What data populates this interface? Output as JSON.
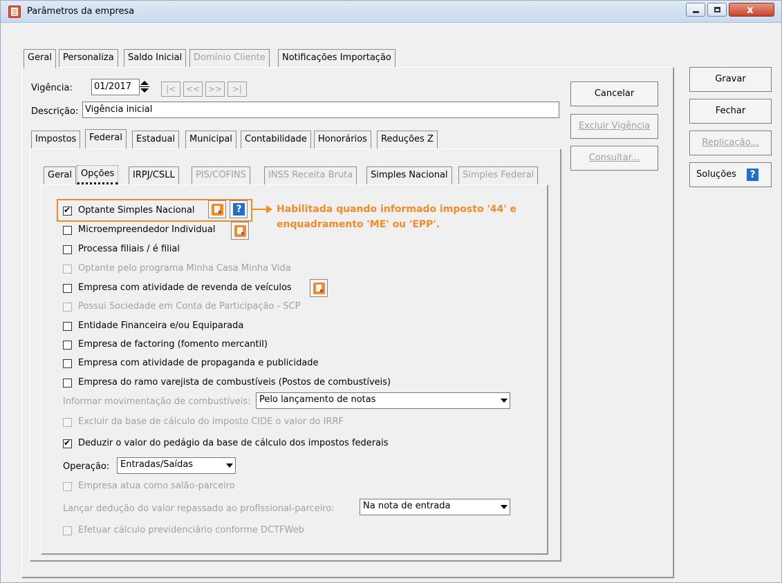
{
  "window": {
    "title": "Parâmetros da empresa",
    "close_symbol": "x"
  },
  "top_tabs": [
    "Geral",
    "Personaliza",
    "Saldo Inicial",
    "Domínio Cliente",
    "Notificações Importação"
  ],
  "vigencia": {
    "label": "Vigência:",
    "value": "01/2017",
    "nav": [
      "|<",
      "<<",
      ">>",
      ">|"
    ]
  },
  "descricao": {
    "label": "Descrição:",
    "value": "Vigência inicial"
  },
  "mid_tabs": [
    "Impostos",
    "Federal",
    "Estadual",
    "Municipal",
    "Contabilidade",
    "Honorários",
    "Reduções Z"
  ],
  "inner_tabs": [
    "Geral",
    "Opções",
    "IRPJ/CSLL",
    "PIS/COFINS",
    "INSS Receita Bruta",
    "Simples Nacional",
    "Simples Federal"
  ],
  "options": [
    {
      "label": "Optante Simples Nacional",
      "checked": true,
      "enabled": true
    },
    {
      "label": "Microempreendedor Individual",
      "checked": false,
      "enabled": true
    },
    {
      "label": "Processa filiais / é filial",
      "checked": false,
      "enabled": true
    },
    {
      "label": "Optante pelo programa Minha Casa Minha Vida",
      "checked": false,
      "enabled": false
    },
    {
      "label": "Empresa com atividade de revenda de veículos",
      "checked": false,
      "enabled": true
    },
    {
      "label": "Possui Sociedade em Conta de Participação - SCP",
      "checked": false,
      "enabled": false
    },
    {
      "label": "Entidade Financeira e/ou Equiparada",
      "checked": false,
      "enabled": true
    },
    {
      "label": "Empresa de factoring (fomento mercantil)",
      "checked": false,
      "enabled": true
    },
    {
      "label": "Empresa com atividade de propaganda e publicidade",
      "checked": false,
      "enabled": true
    },
    {
      "label": "Empresa do ramo varejista de combustíveis (Postos de combustíveis)",
      "checked": false,
      "enabled": true
    }
  ],
  "combustiveis": {
    "label": "Informar movimentação de combustíveis:",
    "value": "Pelo lançamento de notas"
  },
  "excluir_cide": {
    "label": "Excluir da base de cálculo do imposto CIDE o valor do IRRF",
    "checked": false,
    "enabled": false
  },
  "deduzir_pedagio": {
    "label": "Deduzir o valor do pedágio da base de cálculo dos impostos federais",
    "checked": true,
    "enabled": true
  },
  "operacao": {
    "label": "Operação:",
    "value": "Entradas/Saídas"
  },
  "salao": {
    "label": "Empresa atua como salão-parceiro",
    "checked": false,
    "enabled": false
  },
  "deducao": {
    "label": "Lançar dedução do valor repassado ao profissional-parceiro:",
    "value": "Na nota de entrada"
  },
  "dctfweb": {
    "label": "Efetuar cálculo previdenciário conforme DCTFWeb",
    "checked": false,
    "enabled": false
  },
  "callout": {
    "line1": "Habilitada quando informado imposto '44' e",
    "line2": "enquadramento 'ME' ou 'EPP'.",
    "color": "#f28c28"
  },
  "buttons": {
    "cancelar": "Cancelar",
    "excluir_vigencia": "Excluir Vigência",
    "consultar": "Consultar...",
    "gravar": "Gravar",
    "fechar": "Fechar",
    "replicacao": "Replicação...",
    "solucoes": "Soluções"
  },
  "icons": {
    "help": "?",
    "doc": "document-icon"
  }
}
